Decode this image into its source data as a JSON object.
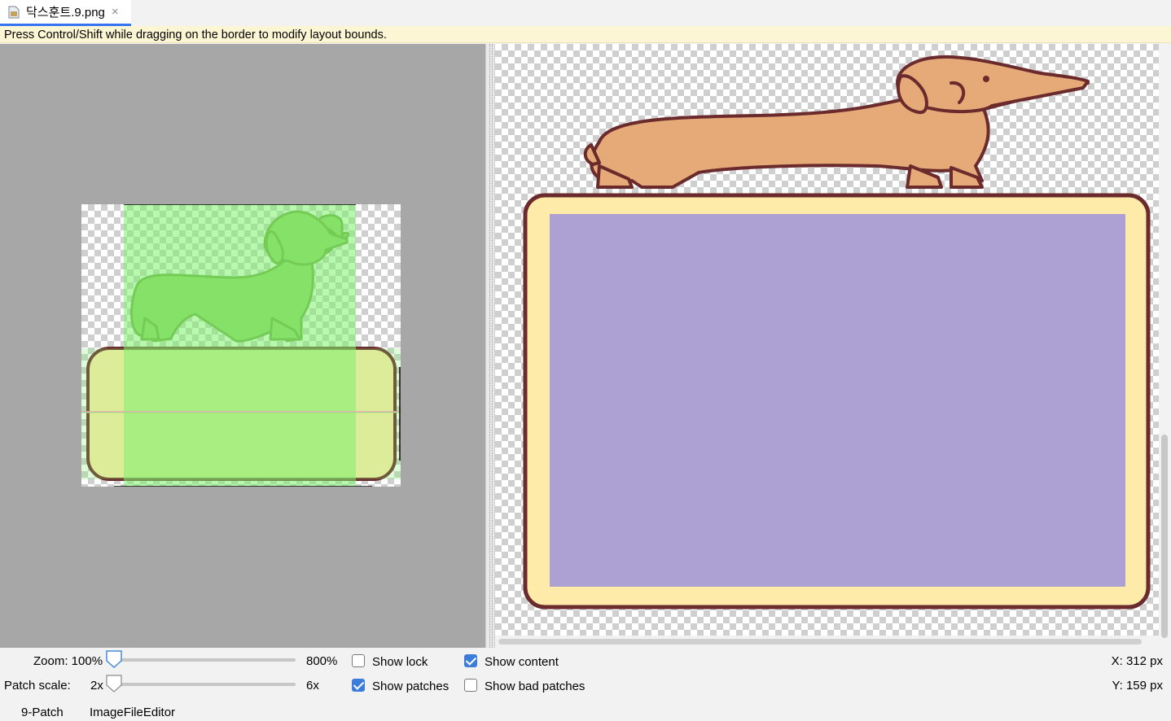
{
  "tab": {
    "filename": "닥스훈트.9.png",
    "close": "×"
  },
  "hint": "Press Control/Shift while dragging on the border to modify layout bounds.",
  "controls": {
    "zoom_label": "Zoom: 100%",
    "zoom_max": "800%",
    "patch_scale_label": "Patch scale:",
    "patch_scale_min": "2x",
    "patch_scale_max": "6x",
    "show_lock": "Show lock",
    "show_lock_checked": false,
    "show_patches": "Show patches",
    "show_patches_checked": true,
    "show_content": "Show content",
    "show_content_checked": true,
    "show_bad_patches": "Show bad patches",
    "show_bad_patches_checked": false,
    "x_coord": "X: 312 px",
    "y_coord": "Y: 159 px"
  },
  "bottom_tabs": [
    "9-Patch",
    "ImageFileEditor"
  ],
  "colors": {
    "accent": "#3574f0",
    "patch_green": "#7cf06c",
    "content_purple": "#ada1d4",
    "panel_yellow": "#feeba9",
    "outline_brown": "#6b2a2c",
    "dog_tan": "#e6aa78",
    "dog_green": "#93cf66"
  },
  "icons": [
    "file-image-icon",
    "close-icon",
    "slider-knob-icon",
    "checkbox-icon"
  ]
}
